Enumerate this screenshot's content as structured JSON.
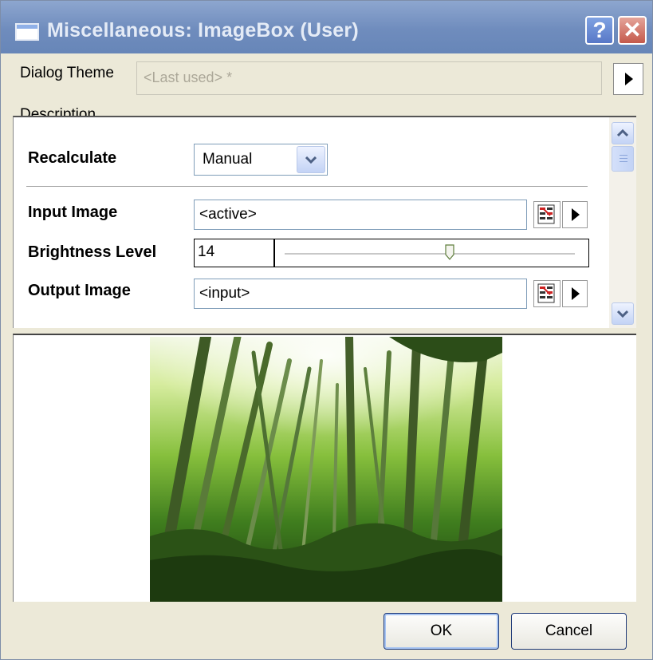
{
  "window": {
    "title": "Miscellaneous: ImageBox (User)",
    "help_label": "?",
    "close_label": "✕"
  },
  "theme": {
    "label": "Dialog Theme",
    "value": "<Last used> *"
  },
  "description": {
    "label": "Description"
  },
  "params": {
    "recalculate": {
      "label": "Recalculate",
      "value": "Manual"
    },
    "input_image": {
      "label": "Input Image",
      "value": "<active>"
    },
    "brightness": {
      "label": "Brightness Level",
      "value": "14",
      "slider_fraction": 0.57
    },
    "output_image": {
      "label": "Output Image",
      "value": "<input>"
    }
  },
  "buttons": {
    "ok": "OK",
    "cancel": "Cancel"
  },
  "colors": {
    "titlebar": "#7691c1",
    "dialog_bg": "#ece9d8",
    "accent": "#1f3a78"
  },
  "icons": [
    "app-window-icon",
    "help-icon",
    "close-icon",
    "arrow-right-icon",
    "scroll-up-icon",
    "scroll-down-icon",
    "chevron-down-icon",
    "workbook-icon",
    "slider-thumb-icon"
  ]
}
